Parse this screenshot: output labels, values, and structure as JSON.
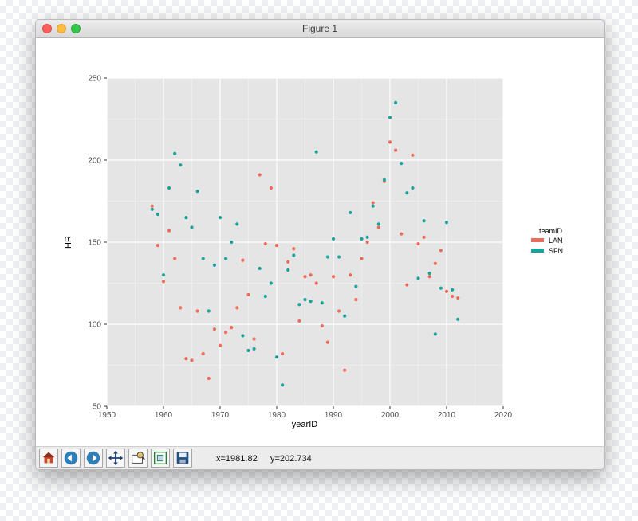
{
  "window": {
    "title": "Figure 1"
  },
  "toolbar": {
    "buttons": [
      {
        "name": "home-icon",
        "label": "home"
      },
      {
        "name": "back-icon",
        "label": "back"
      },
      {
        "name": "forward-icon",
        "label": "forward"
      },
      {
        "name": "pan-icon",
        "label": "pan"
      },
      {
        "name": "zoom-icon",
        "label": "zoom"
      },
      {
        "name": "configure-subplots-icon",
        "label": "configure subplots"
      },
      {
        "name": "save-icon",
        "label": "save"
      }
    ],
    "x_readout": "x=1981.82",
    "y_readout": "y=202.734"
  },
  "colors": {
    "LAN": "#ec6c5a",
    "SFN": "#1aa39b",
    "panel": "#e5e5e5",
    "grid": "#ffffff"
  },
  "chart_data": {
    "type": "scatter",
    "title": "",
    "xlabel": "yearID",
    "ylabel": "HR",
    "xlim": [
      1950,
      2020
    ],
    "ylim": [
      50,
      250
    ],
    "x_ticks": [
      "1950",
      "1960",
      "1970",
      "1980",
      "1990",
      "2000",
      "2010",
      "2020"
    ],
    "y_ticks": [
      "50",
      "100",
      "150",
      "200",
      "250"
    ],
    "grid": true,
    "legend": {
      "title": "teamID",
      "placement": "right",
      "entries": [
        "LAN",
        "SFN"
      ]
    },
    "series": [
      {
        "name": "LAN",
        "color": "#ec6c5a",
        "points": [
          [
            1958,
            172
          ],
          [
            1959,
            148
          ],
          [
            1960,
            126
          ],
          [
            1961,
            157
          ],
          [
            1962,
            140
          ],
          [
            1963,
            110
          ],
          [
            1964,
            79
          ],
          [
            1965,
            78
          ],
          [
            1966,
            108
          ],
          [
            1967,
            82
          ],
          [
            1968,
            67
          ],
          [
            1969,
            97
          ],
          [
            1970,
            87
          ],
          [
            1971,
            95
          ],
          [
            1972,
            98
          ],
          [
            1973,
            110
          ],
          [
            1974,
            139
          ],
          [
            1975,
            118
          ],
          [
            1976,
            91
          ],
          [
            1977,
            191
          ],
          [
            1978,
            149
          ],
          [
            1979,
            183
          ],
          [
            1980,
            148
          ],
          [
            1981,
            82
          ],
          [
            1982,
            138
          ],
          [
            1983,
            146
          ],
          [
            1984,
            102
          ],
          [
            1985,
            129
          ],
          [
            1986,
            130
          ],
          [
            1987,
            125
          ],
          [
            1988,
            99
          ],
          [
            1989,
            89
          ],
          [
            1990,
            129
          ],
          [
            1991,
            108
          ],
          [
            1992,
            72
          ],
          [
            1993,
            130
          ],
          [
            1994,
            115
          ],
          [
            1995,
            140
          ],
          [
            1996,
            150
          ],
          [
            1997,
            174
          ],
          [
            1998,
            159
          ],
          [
            1999,
            187
          ],
          [
            2000,
            211
          ],
          [
            2001,
            206
          ],
          [
            2002,
            155
          ],
          [
            2003,
            124
          ],
          [
            2004,
            203
          ],
          [
            2005,
            149
          ],
          [
            2006,
            153
          ],
          [
            2007,
            129
          ],
          [
            2008,
            137
          ],
          [
            2009,
            145
          ],
          [
            2010,
            120
          ],
          [
            2011,
            117
          ],
          [
            2012,
            116
          ]
        ]
      },
      {
        "name": "SFN",
        "color": "#1aa39b",
        "points": [
          [
            1958,
            170
          ],
          [
            1959,
            167
          ],
          [
            1960,
            130
          ],
          [
            1961,
            183
          ],
          [
            1962,
            204
          ],
          [
            1963,
            197
          ],
          [
            1964,
            165
          ],
          [
            1965,
            159
          ],
          [
            1966,
            181
          ],
          [
            1967,
            140
          ],
          [
            1968,
            108
          ],
          [
            1969,
            136
          ],
          [
            1970,
            165
          ],
          [
            1971,
            140
          ],
          [
            1972,
            150
          ],
          [
            1973,
            161
          ],
          [
            1974,
            93
          ],
          [
            1975,
            84
          ],
          [
            1976,
            85
          ],
          [
            1977,
            134
          ],
          [
            1978,
            117
          ],
          [
            1979,
            125
          ],
          [
            1980,
            80
          ],
          [
            1981,
            63
          ],
          [
            1982,
            133
          ],
          [
            1983,
            142
          ],
          [
            1984,
            112
          ],
          [
            1985,
            115
          ],
          [
            1986,
            114
          ],
          [
            1987,
            205
          ],
          [
            1988,
            113
          ],
          [
            1989,
            141
          ],
          [
            1990,
            152
          ],
          [
            1991,
            141
          ],
          [
            1992,
            105
          ],
          [
            1993,
            168
          ],
          [
            1994,
            123
          ],
          [
            1995,
            152
          ],
          [
            1996,
            153
          ],
          [
            1997,
            172
          ],
          [
            1998,
            161
          ],
          [
            1999,
            188
          ],
          [
            2000,
            226
          ],
          [
            2001,
            235
          ],
          [
            2002,
            198
          ],
          [
            2003,
            180
          ],
          [
            2004,
            183
          ],
          [
            2005,
            128
          ],
          [
            2006,
            163
          ],
          [
            2007,
            131
          ],
          [
            2008,
            94
          ],
          [
            2009,
            122
          ],
          [
            2010,
            162
          ],
          [
            2011,
            121
          ],
          [
            2012,
            103
          ]
        ]
      }
    ]
  }
}
